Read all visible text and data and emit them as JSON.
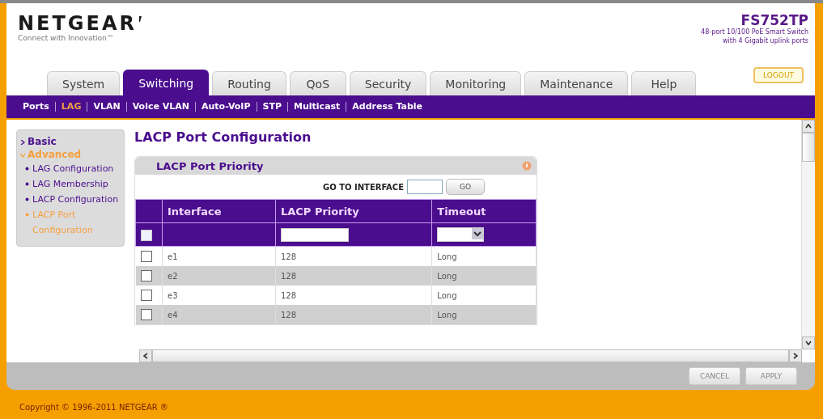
{
  "header": {
    "logo": "NETGEAR",
    "tagline": "Connect with Innovation™",
    "model": "FS752TP",
    "description": [
      "48-port 10/100 PoE Smart Switch",
      "with 4 Gigabit uplink ports"
    ]
  },
  "tabs": [
    {
      "label": "System",
      "selected": false
    },
    {
      "label": "Switching",
      "selected": true
    },
    {
      "label": "Routing",
      "selected": false
    },
    {
      "label": "QoS",
      "selected": false
    },
    {
      "label": "Security",
      "selected": false
    },
    {
      "label": "Monitoring",
      "selected": false
    },
    {
      "label": "Maintenance",
      "selected": false
    },
    {
      "label": "Help",
      "selected": false
    }
  ],
  "logout": "LOGOUT",
  "subnav": [
    {
      "label": "Ports",
      "selected": false
    },
    {
      "label": "LAG",
      "selected": true
    },
    {
      "label": "VLAN",
      "selected": false
    },
    {
      "label": "Voice VLAN",
      "selected": false
    },
    {
      "label": "Auto-VoIP",
      "selected": false
    },
    {
      "label": "STP",
      "selected": false
    },
    {
      "label": "Multicast",
      "selected": false
    },
    {
      "label": "Address Table",
      "selected": false
    }
  ],
  "sidebar": {
    "items": [
      {
        "label": "Basic",
        "selected": false,
        "expanded": false
      },
      {
        "label": "Advanced",
        "selected": true,
        "expanded": true,
        "children": [
          {
            "label": "LAG Configuration",
            "selected": false
          },
          {
            "label": "LAG Membership",
            "selected": false
          },
          {
            "label": "LACP Configuration",
            "selected": false
          },
          {
            "label": "LACP Port Configuration",
            "selected": true
          }
        ]
      }
    ]
  },
  "page_title": "LACP Port Configuration",
  "panel": {
    "title": "LACP Port Priority",
    "go_label": "GO TO INTERFACE",
    "go_button": "GO",
    "columns": [
      "Interface",
      "LACP Priority",
      "Timeout"
    ],
    "filter_row": {
      "checked": false
    },
    "rows": [
      {
        "checked": false,
        "interface": "e1",
        "priority": "128",
        "timeout": "Long"
      },
      {
        "checked": false,
        "interface": "e2",
        "priority": "128",
        "timeout": "Long"
      },
      {
        "checked": false,
        "interface": "e3",
        "priority": "128",
        "timeout": "Long"
      },
      {
        "checked": false,
        "interface": "e4",
        "priority": "128",
        "timeout": "Long"
      }
    ]
  },
  "buttons": [
    "CANCEL",
    "APPLY"
  ],
  "footer": "Copyright © 1996-2011 NETGEAR ®"
}
